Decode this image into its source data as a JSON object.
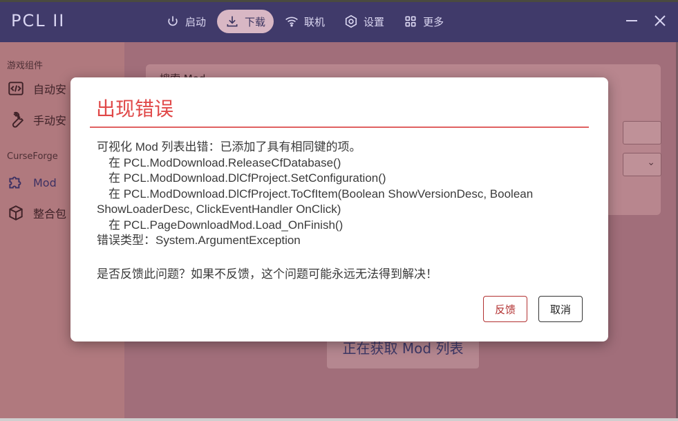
{
  "app": {
    "title": "PCL II"
  },
  "nav": [
    {
      "label": "启动",
      "icon": "power-icon"
    },
    {
      "label": "下载",
      "icon": "download-icon",
      "active": true
    },
    {
      "label": "联机",
      "icon": "wifi-icon"
    },
    {
      "label": "设置",
      "icon": "gear-icon"
    },
    {
      "label": "更多",
      "icon": "grid-icon"
    }
  ],
  "window": {
    "minimize": "—",
    "close": "✕"
  },
  "sidebar": {
    "section_game": "游戏组件",
    "section_curseforge": "CurseForge",
    "items": [
      {
        "label": "自动安",
        "icon": "code-icon"
      },
      {
        "label": "手动安",
        "icon": "wrench-icon"
      },
      {
        "label": "Mod",
        "icon": "puzzle-icon",
        "active": true
      },
      {
        "label": "整合包",
        "icon": "box-icon"
      }
    ]
  },
  "main": {
    "card_title": "搜索 Mod",
    "loading_text": "正在获取 Mod 列表"
  },
  "dialog": {
    "title": "出现错误",
    "message_lines": [
      "可视化 Mod 列表出错：已添加了具有相同键的项。",
      "在 PCL.ModDownload.ReleaseCfDatabase()",
      "在 PCL.ModDownload.DlCfProject.SetConfiguration()",
      "在 PCL.ModDownload.DlCfProject.ToCfItem(Boolean ShowVersionDesc, Boolean",
      "ShowLoaderDesc, ClickEventHandler OnClick)",
      "在 PCL.PageDownloadMod.Load_OnFinish()",
      "错误类型：System.ArgumentException"
    ],
    "question": "是否反馈此问题？如果不反馈，这个问题可能永远无法得到解决！",
    "feedback_label": "反馈",
    "cancel_label": "取消"
  },
  "colors": {
    "accent": "#e04848",
    "titlebar": "#403a6a",
    "sidebar": "#b0797e"
  }
}
